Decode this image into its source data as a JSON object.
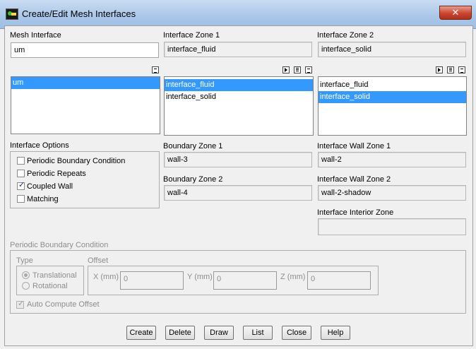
{
  "window": {
    "title": "Create/Edit Mesh Interfaces",
    "close_glyph": "✕"
  },
  "mesh_interface": {
    "label": "Mesh Interface",
    "input_value": "um",
    "list_items": [
      {
        "label": "um",
        "selected": true
      }
    ]
  },
  "interface_zone_1": {
    "label": "Interface Zone 1",
    "value": "interface_fluid",
    "list_items": [
      {
        "label": "interface_fluid",
        "selected": true
      },
      {
        "label": "interface_solid",
        "selected": false
      }
    ]
  },
  "interface_zone_2": {
    "label": "Interface Zone 2",
    "value": "interface_solid",
    "list_items": [
      {
        "label": "interface_fluid",
        "selected": false
      },
      {
        "label": "interface_solid",
        "selected": true
      }
    ]
  },
  "interface_options": {
    "label": "Interface Options",
    "options": [
      {
        "label": "Periodic Boundary Condition",
        "checked": false
      },
      {
        "label": "Periodic Repeats",
        "checked": false
      },
      {
        "label": "Coupled Wall",
        "checked": true
      },
      {
        "label": "Matching",
        "checked": false
      }
    ]
  },
  "boundary_zone_1": {
    "label": "Boundary Zone 1",
    "value": "wall-3"
  },
  "boundary_zone_2": {
    "label": "Boundary Zone 2",
    "value": "wall-4"
  },
  "interface_wall_zone_1": {
    "label": "Interface Wall Zone 1",
    "value": "wall-2"
  },
  "interface_wall_zone_2": {
    "label": "Interface Wall Zone 2",
    "value": "wall-2-shadow"
  },
  "interface_interior_zone": {
    "label": "Interface Interior Zone",
    "value": ""
  },
  "periodic": {
    "label": "Periodic Boundary Condition",
    "type": {
      "label": "Type",
      "options": [
        {
          "label": "Translational",
          "selected": true
        },
        {
          "label": "Rotational",
          "selected": false
        }
      ]
    },
    "offset": {
      "label": "Offset",
      "x_label": "X (mm)",
      "x_value": "0",
      "y_label": "Y (mm)",
      "y_value": "0",
      "z_label": "Z (mm)",
      "z_value": "0"
    },
    "auto_compute": {
      "label": "Auto Compute Offset",
      "checked": true
    }
  },
  "buttons": {
    "create": "Create",
    "delete": "Delete",
    "draw": "Draw",
    "list": "List",
    "close": "Close",
    "help": "Help"
  },
  "icons": {
    "select_all": "select-all-icon",
    "deselect_all": "deselect-all-icon",
    "filter": "filter-icon"
  }
}
